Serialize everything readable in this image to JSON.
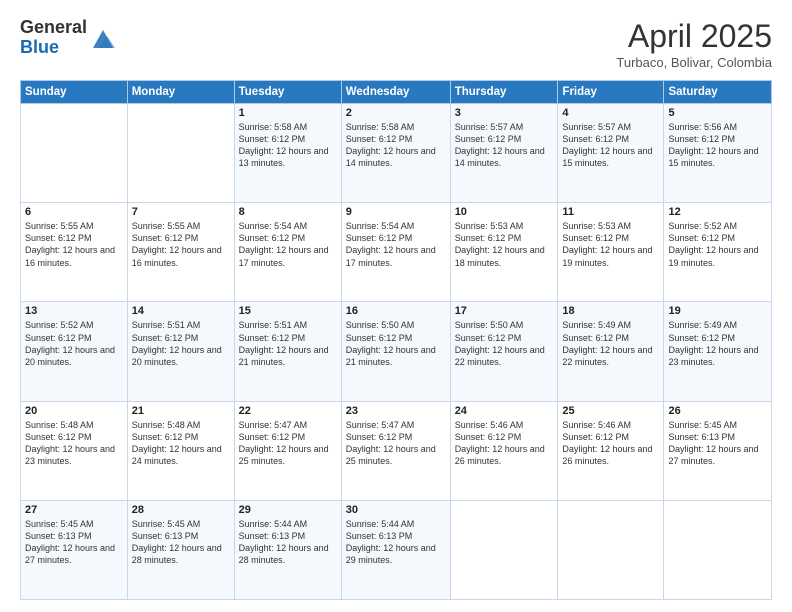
{
  "logo": {
    "general": "General",
    "blue": "Blue"
  },
  "header": {
    "month_title": "April 2025",
    "location": "Turbaco, Bolivar, Colombia"
  },
  "weekdays": [
    "Sunday",
    "Monday",
    "Tuesday",
    "Wednesday",
    "Thursday",
    "Friday",
    "Saturday"
  ],
  "weeks": [
    [
      {
        "day": "",
        "info": ""
      },
      {
        "day": "",
        "info": ""
      },
      {
        "day": "1",
        "info": "Sunrise: 5:58 AM\nSunset: 6:12 PM\nDaylight: 12 hours and 13 minutes."
      },
      {
        "day": "2",
        "info": "Sunrise: 5:58 AM\nSunset: 6:12 PM\nDaylight: 12 hours and 14 minutes."
      },
      {
        "day": "3",
        "info": "Sunrise: 5:57 AM\nSunset: 6:12 PM\nDaylight: 12 hours and 14 minutes."
      },
      {
        "day": "4",
        "info": "Sunrise: 5:57 AM\nSunset: 6:12 PM\nDaylight: 12 hours and 15 minutes."
      },
      {
        "day": "5",
        "info": "Sunrise: 5:56 AM\nSunset: 6:12 PM\nDaylight: 12 hours and 15 minutes."
      }
    ],
    [
      {
        "day": "6",
        "info": "Sunrise: 5:55 AM\nSunset: 6:12 PM\nDaylight: 12 hours and 16 minutes."
      },
      {
        "day": "7",
        "info": "Sunrise: 5:55 AM\nSunset: 6:12 PM\nDaylight: 12 hours and 16 minutes."
      },
      {
        "day": "8",
        "info": "Sunrise: 5:54 AM\nSunset: 6:12 PM\nDaylight: 12 hours and 17 minutes."
      },
      {
        "day": "9",
        "info": "Sunrise: 5:54 AM\nSunset: 6:12 PM\nDaylight: 12 hours and 17 minutes."
      },
      {
        "day": "10",
        "info": "Sunrise: 5:53 AM\nSunset: 6:12 PM\nDaylight: 12 hours and 18 minutes."
      },
      {
        "day": "11",
        "info": "Sunrise: 5:53 AM\nSunset: 6:12 PM\nDaylight: 12 hours and 19 minutes."
      },
      {
        "day": "12",
        "info": "Sunrise: 5:52 AM\nSunset: 6:12 PM\nDaylight: 12 hours and 19 minutes."
      }
    ],
    [
      {
        "day": "13",
        "info": "Sunrise: 5:52 AM\nSunset: 6:12 PM\nDaylight: 12 hours and 20 minutes."
      },
      {
        "day": "14",
        "info": "Sunrise: 5:51 AM\nSunset: 6:12 PM\nDaylight: 12 hours and 20 minutes."
      },
      {
        "day": "15",
        "info": "Sunrise: 5:51 AM\nSunset: 6:12 PM\nDaylight: 12 hours and 21 minutes."
      },
      {
        "day": "16",
        "info": "Sunrise: 5:50 AM\nSunset: 6:12 PM\nDaylight: 12 hours and 21 minutes."
      },
      {
        "day": "17",
        "info": "Sunrise: 5:50 AM\nSunset: 6:12 PM\nDaylight: 12 hours and 22 minutes."
      },
      {
        "day": "18",
        "info": "Sunrise: 5:49 AM\nSunset: 6:12 PM\nDaylight: 12 hours and 22 minutes."
      },
      {
        "day": "19",
        "info": "Sunrise: 5:49 AM\nSunset: 6:12 PM\nDaylight: 12 hours and 23 minutes."
      }
    ],
    [
      {
        "day": "20",
        "info": "Sunrise: 5:48 AM\nSunset: 6:12 PM\nDaylight: 12 hours and 23 minutes."
      },
      {
        "day": "21",
        "info": "Sunrise: 5:48 AM\nSunset: 6:12 PM\nDaylight: 12 hours and 24 minutes."
      },
      {
        "day": "22",
        "info": "Sunrise: 5:47 AM\nSunset: 6:12 PM\nDaylight: 12 hours and 25 minutes."
      },
      {
        "day": "23",
        "info": "Sunrise: 5:47 AM\nSunset: 6:12 PM\nDaylight: 12 hours and 25 minutes."
      },
      {
        "day": "24",
        "info": "Sunrise: 5:46 AM\nSunset: 6:12 PM\nDaylight: 12 hours and 26 minutes."
      },
      {
        "day": "25",
        "info": "Sunrise: 5:46 AM\nSunset: 6:12 PM\nDaylight: 12 hours and 26 minutes."
      },
      {
        "day": "26",
        "info": "Sunrise: 5:45 AM\nSunset: 6:13 PM\nDaylight: 12 hours and 27 minutes."
      }
    ],
    [
      {
        "day": "27",
        "info": "Sunrise: 5:45 AM\nSunset: 6:13 PM\nDaylight: 12 hours and 27 minutes."
      },
      {
        "day": "28",
        "info": "Sunrise: 5:45 AM\nSunset: 6:13 PM\nDaylight: 12 hours and 28 minutes."
      },
      {
        "day": "29",
        "info": "Sunrise: 5:44 AM\nSunset: 6:13 PM\nDaylight: 12 hours and 28 minutes."
      },
      {
        "day": "30",
        "info": "Sunrise: 5:44 AM\nSunset: 6:13 PM\nDaylight: 12 hours and 29 minutes."
      },
      {
        "day": "",
        "info": ""
      },
      {
        "day": "",
        "info": ""
      },
      {
        "day": "",
        "info": ""
      }
    ]
  ]
}
